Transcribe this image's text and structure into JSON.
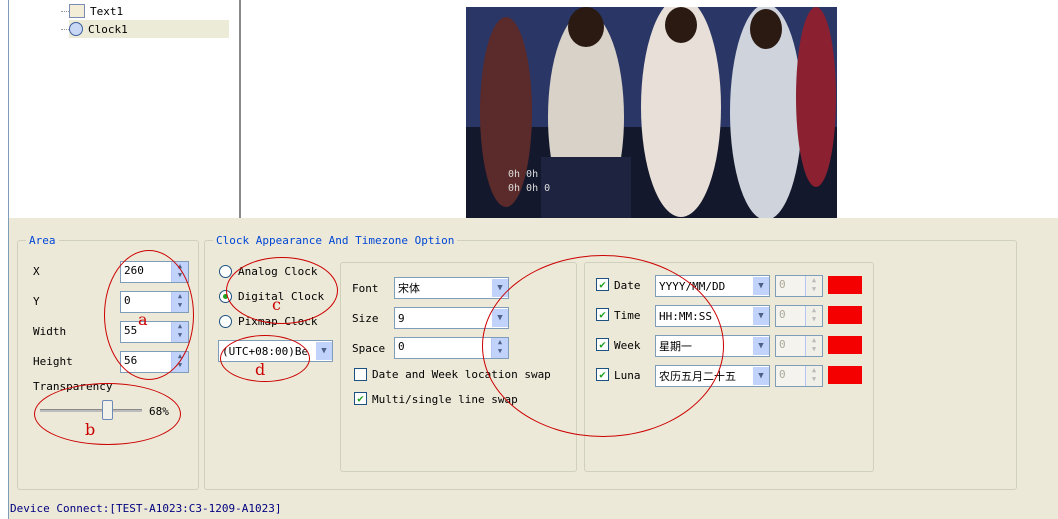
{
  "tree": {
    "items": [
      {
        "label": "Text1"
      },
      {
        "label": "Clock1"
      }
    ]
  },
  "preview": {
    "overlay_line1": "0h 0h",
    "overlay_line2": "0h 0h 0"
  },
  "area": {
    "legend": "Area",
    "x_label": "X",
    "x_value": "260",
    "y_label": "Y",
    "y_value": "0",
    "width_label": "Width",
    "width_value": "55",
    "height_label": "Height",
    "height_value": "56",
    "transparency_label": "Transparency",
    "transparency_pct": 68,
    "transparency_text": "68%"
  },
  "clock": {
    "legend": "Clock Appearance And Timezone Option",
    "analog_label": "Analog Clock",
    "digital_label": "Digital Clock",
    "pixmap_label": "Pixmap Clock",
    "selected": "digital",
    "timezone": "(UTC+08:00)Be",
    "font_label": "Font",
    "font_value": "宋体",
    "size_label": "Size",
    "size_value": "9",
    "space_label": "Space",
    "space_value": "0",
    "swap_date_week_label": "Date and Week location swap",
    "swap_date_week_checked": false,
    "multi_single_label": "Multi/single line swap",
    "multi_single_checked": true
  },
  "display": {
    "rows": [
      {
        "label": "Date",
        "format": "YYYY/MM/DD",
        "num": "0",
        "color": "#f40000"
      },
      {
        "label": "Time",
        "format": "HH:MM:SS",
        "num": "0",
        "color": "#f40000"
      },
      {
        "label": "Week",
        "format": "星期一",
        "num": "0",
        "color": "#f40000"
      },
      {
        "label": "Luna",
        "format": "农历五月二十五",
        "num": "0",
        "color": "#f40000"
      }
    ]
  },
  "annotations": {
    "a": "a",
    "b": "b",
    "c": "c",
    "d": "d"
  },
  "status": {
    "text": "Device Connect:[TEST-A1023:C3-1209-A1023]"
  }
}
